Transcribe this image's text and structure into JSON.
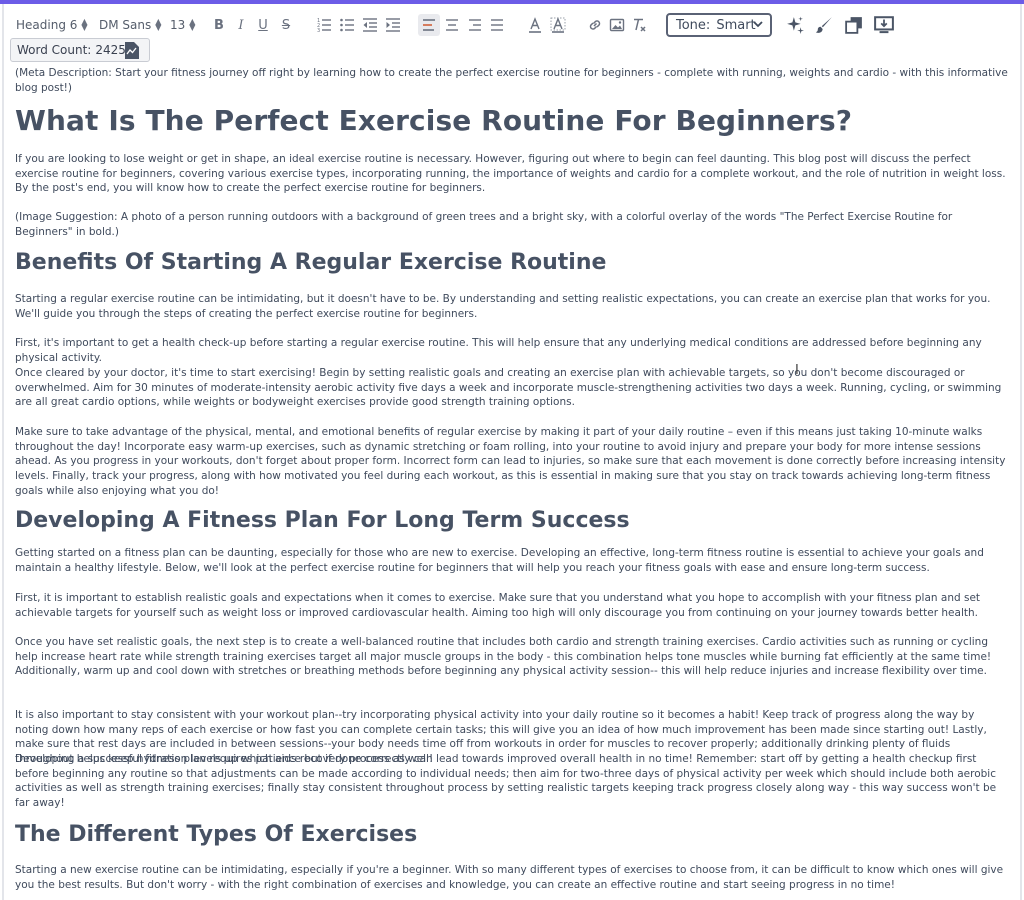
{
  "toolbar": {
    "block_format": "Heading 6",
    "font_family": "DM Sans",
    "font_size": "13",
    "bold": "B",
    "italic": "I",
    "underline": "U",
    "strike": "S",
    "tone_label": "Tone:",
    "tone_value": "Smart",
    "icons": [
      "ordered-list-icon",
      "bullet-list-icon",
      "outdent-icon",
      "indent-icon",
      "align-left-icon",
      "align-center-icon",
      "align-right-icon",
      "align-justify-icon",
      "text-color-icon",
      "highlight-icon",
      "link-icon",
      "image-icon",
      "clear-format-icon",
      "sparkle-icon",
      "brush-icon",
      "copy-icon",
      "monitor-download-icon"
    ]
  },
  "word_count": {
    "label": "Word Count:",
    "value": "2425"
  },
  "article": {
    "meta": "(Meta Description: Start your fitness journey off right by learning how to create the perfect exercise routine for beginners - complete with running, weights and cardio - with this informative blog post!)",
    "title": "What Is The Perfect Exercise Routine For Beginners?",
    "intro": "If you are looking to lose weight or get in shape, an ideal exercise routine is necessary. However, figuring out where to begin can feel daunting. This blog post will discuss the perfect exercise routine for beginners, covering various exercise types, incorporating running, the importance of weights and cardio for a complete workout, and the role of nutrition in weight loss. By the post's end, you will know how to create the perfect exercise routine for beginners.",
    "image_suggestion": "(Image Suggestion: A photo of a person running outdoors with a background of green trees and a bright sky, with a colorful overlay of the words \"The Perfect Exercise Routine for Beginners\" in bold.)",
    "h2_benefits": "Benefits Of Starting A Regular Exercise Routine",
    "benefits_p1": "Starting a regular exercise routine can be intimidating, but it doesn't have to be. By understanding and setting realistic expectations, you can create an exercise plan that works for you. We'll guide you through the steps of creating the perfect exercise routine for beginners.",
    "benefits_p2": "First, it's important to get a health check-up before starting a regular exercise routine. This will help ensure that any underlying medical conditions are addressed before beginning any physical activity.",
    "benefits_p3": "Once cleared by your doctor, it's time to start exercising! Begin by setting realistic goals and creating an exercise plan with achievable targets, so you don't become discouraged or overwhelmed. Aim for 30 minutes of moderate-intensity aerobic activity five days a week and incorporate muscle-strengthening activities two days a week. Running, cycling, or swimming are all great cardio options, while weights or bodyweight exercises provide good strength training options.",
    "benefits_p4": "Make sure to take advantage of the physical, mental, and emotional benefits of regular exercise by making it part of your daily routine – even if this means just taking 10-minute walks throughout the day! Incorporate easy warm-up exercises, such as dynamic stretching or foam rolling, into your routine to avoid injury and prepare your body for more intense sessions ahead. As you progress in your workouts, don't forget about proper form. Incorrect form can lead to injuries, so make sure that each movement is done correctly before increasing intensity levels. Finally, track your progress, along with how motivated you feel during each workout, as this is essential in making sure that you stay on track towards achieving long-term fitness goals while also enjoying what you do!",
    "h2_plan": "Developing A Fitness Plan For Long Term Success",
    "plan_p1": "Getting started on a fitness plan can be daunting, especially for those who are new to exercise. Developing an effective, long-term fitness routine is essential to achieve your goals and maintain a healthy lifestyle. Below, we'll look at the perfect exercise routine for beginners that will help you reach your fitness goals with ease and ensure long-term success.",
    "plan_p2": "First, it is important to establish realistic goals and expectations when it comes to exercise. Make sure that you understand what you hope to accomplish with your fitness plan and set achievable targets for yourself such as weight loss or improved cardiovascular health. Aiming too high will only discourage you from continuing on your journey towards better health.",
    "plan_p3": "Once you have set realistic goals, the next step is to create a well-balanced routine that includes both cardio and strength training exercises. Cardio activities such as running or cycling help increase heart rate while strength training exercises target all major muscle groups in the body - this combination helps tone muscles while burning fat efficiently at the same time! Additionally, warm up and cool down with stretches or breathing methods before beginning any physical activity session-- this will help reduce injuries and increase flexibility over time.",
    "plan_p4": "It is also important to stay consistent with your workout plan--try incorporating physical activity into your daily routine so it becomes a habit! Keep track of progress along the way by noting down how many reps of each exercise or how fast you can complete certain tasks; this will give you an idea of how much improvement has been made since starting out! Lastly, make sure that rest days are included in between sessions--your body needs time off from workouts in order for muscles to recover properly; additionally drinking plenty of fluids throughout helps keep hydration levels up which aids recovery process as well!",
    "plan_p5": "Developing a successful fitness plan requires patience but if done correctly can lead towards improved overall health in no time! Remember: start off by getting a health checkup first before beginning any routine so that adjustments can be made according to individual needs; then aim for two-three days of physical activity per week which should include both aerobic activities as well as strength training exercises; finally stay consistent throughout process by setting realistic targets keeping track progress closely along way - this way success won't be far away!",
    "h2_types": "The Different Types Of Exercises",
    "types_p1": "Starting a new exercise routine can be intimidating, especially if you're a beginner. With so many different types of exercises to choose from, it can be difficult to know which ones will give you the best results. But don't worry - with the right combination of exercises and knowledge, you can create an effective routine and start seeing progress in no time!"
  }
}
